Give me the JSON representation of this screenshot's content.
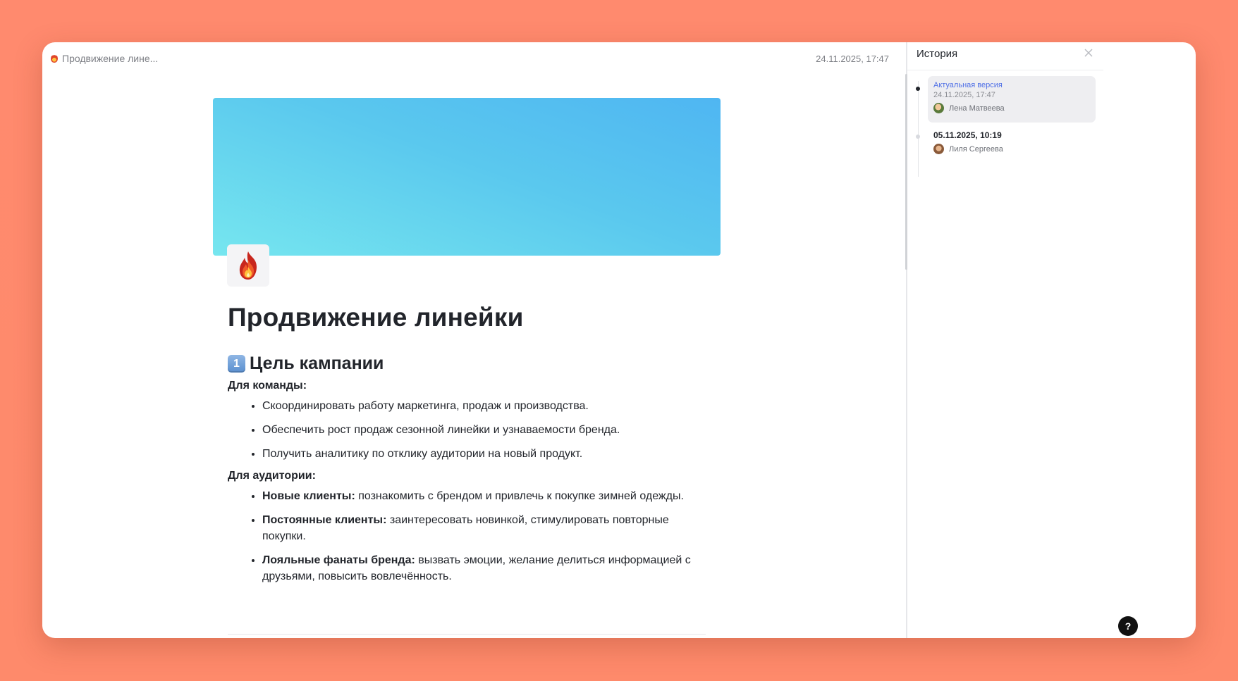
{
  "doc": {
    "breadcrumb_title": "Продвижение лине...",
    "modified_date": "24.11.2025, 17:47",
    "page_icon": "fire-icon",
    "title": "Продвижение линейки",
    "section_number": "1",
    "section_title": "Цель кампании",
    "team_label": "Для команды:",
    "team_items": [
      "Скоординировать работу маркетинга, продаж и производства.",
      "Обеспечить рост продаж сезонной линейки и узнаваемости бренда.",
      "Получить аналитику по отклику аудитории на новый продукт."
    ],
    "audience_label": "Для аудитории:",
    "audience_items": [
      {
        "bold": "Новые клиенты:",
        "text": " познакомить с брендом и привлечь к покупке зимней одежды."
      },
      {
        "bold": "Постоянные клиенты:",
        "text": " заинтересовать новинкой, стимулировать повторные покупки."
      },
      {
        "bold": "Лояльные фанаты бренда:",
        "text": " вызвать эмоции, желание делиться информацией с друзьями, повысить вовлечённость."
      }
    ]
  },
  "history": {
    "title": "История",
    "versions": [
      {
        "label": "Актуальная версия",
        "date": "24.11.2025, 17:47",
        "user": "Лена Матвеева"
      },
      {
        "date": "05.11.2025, 10:19",
        "user": "Лиля Сергеева"
      }
    ],
    "help_label": "?"
  },
  "colors": {
    "background": "#fe8a6b",
    "accent": "#4f6fe6",
    "cover_start": "#4fb6f2",
    "cover_end": "#76e6ef"
  }
}
